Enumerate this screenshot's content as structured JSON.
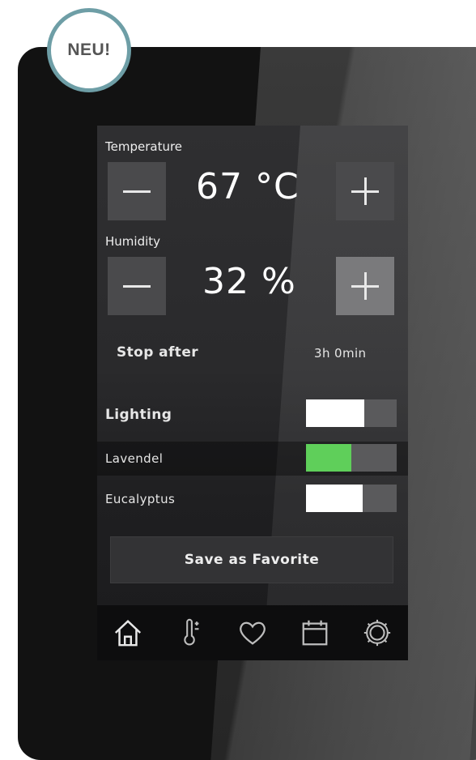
{
  "badge": {
    "text": "NEU!"
  },
  "controls": {
    "temperature": {
      "label": "Temperature",
      "value": "67 °C"
    },
    "humidity": {
      "label": "Humidity",
      "value": "32 %"
    },
    "stop_after": {
      "label": "Stop after",
      "value": "3h 0min"
    }
  },
  "toggles": [
    {
      "label": "Lighting",
      "state": "on",
      "knob_color": "#ffffff"
    },
    {
      "label": "Lavendel",
      "state": "on",
      "knob_color": "#5fcf5a"
    },
    {
      "label": "Eucalyptus",
      "state": "on",
      "knob_color": "#ffffff"
    }
  ],
  "favorite_button": {
    "label": "Save as Favorite"
  },
  "nav": {
    "items": [
      {
        "icon": "home-icon"
      },
      {
        "icon": "thermometer-icon"
      },
      {
        "icon": "heart-icon"
      },
      {
        "icon": "calendar-icon"
      },
      {
        "icon": "gear-icon"
      }
    ]
  },
  "colors": {
    "badge_ring": "#6e9ea6",
    "toggle_on_white": "#ffffff",
    "toggle_on_green": "#5fcf5a",
    "toggle_track": "#5a5a5c"
  }
}
